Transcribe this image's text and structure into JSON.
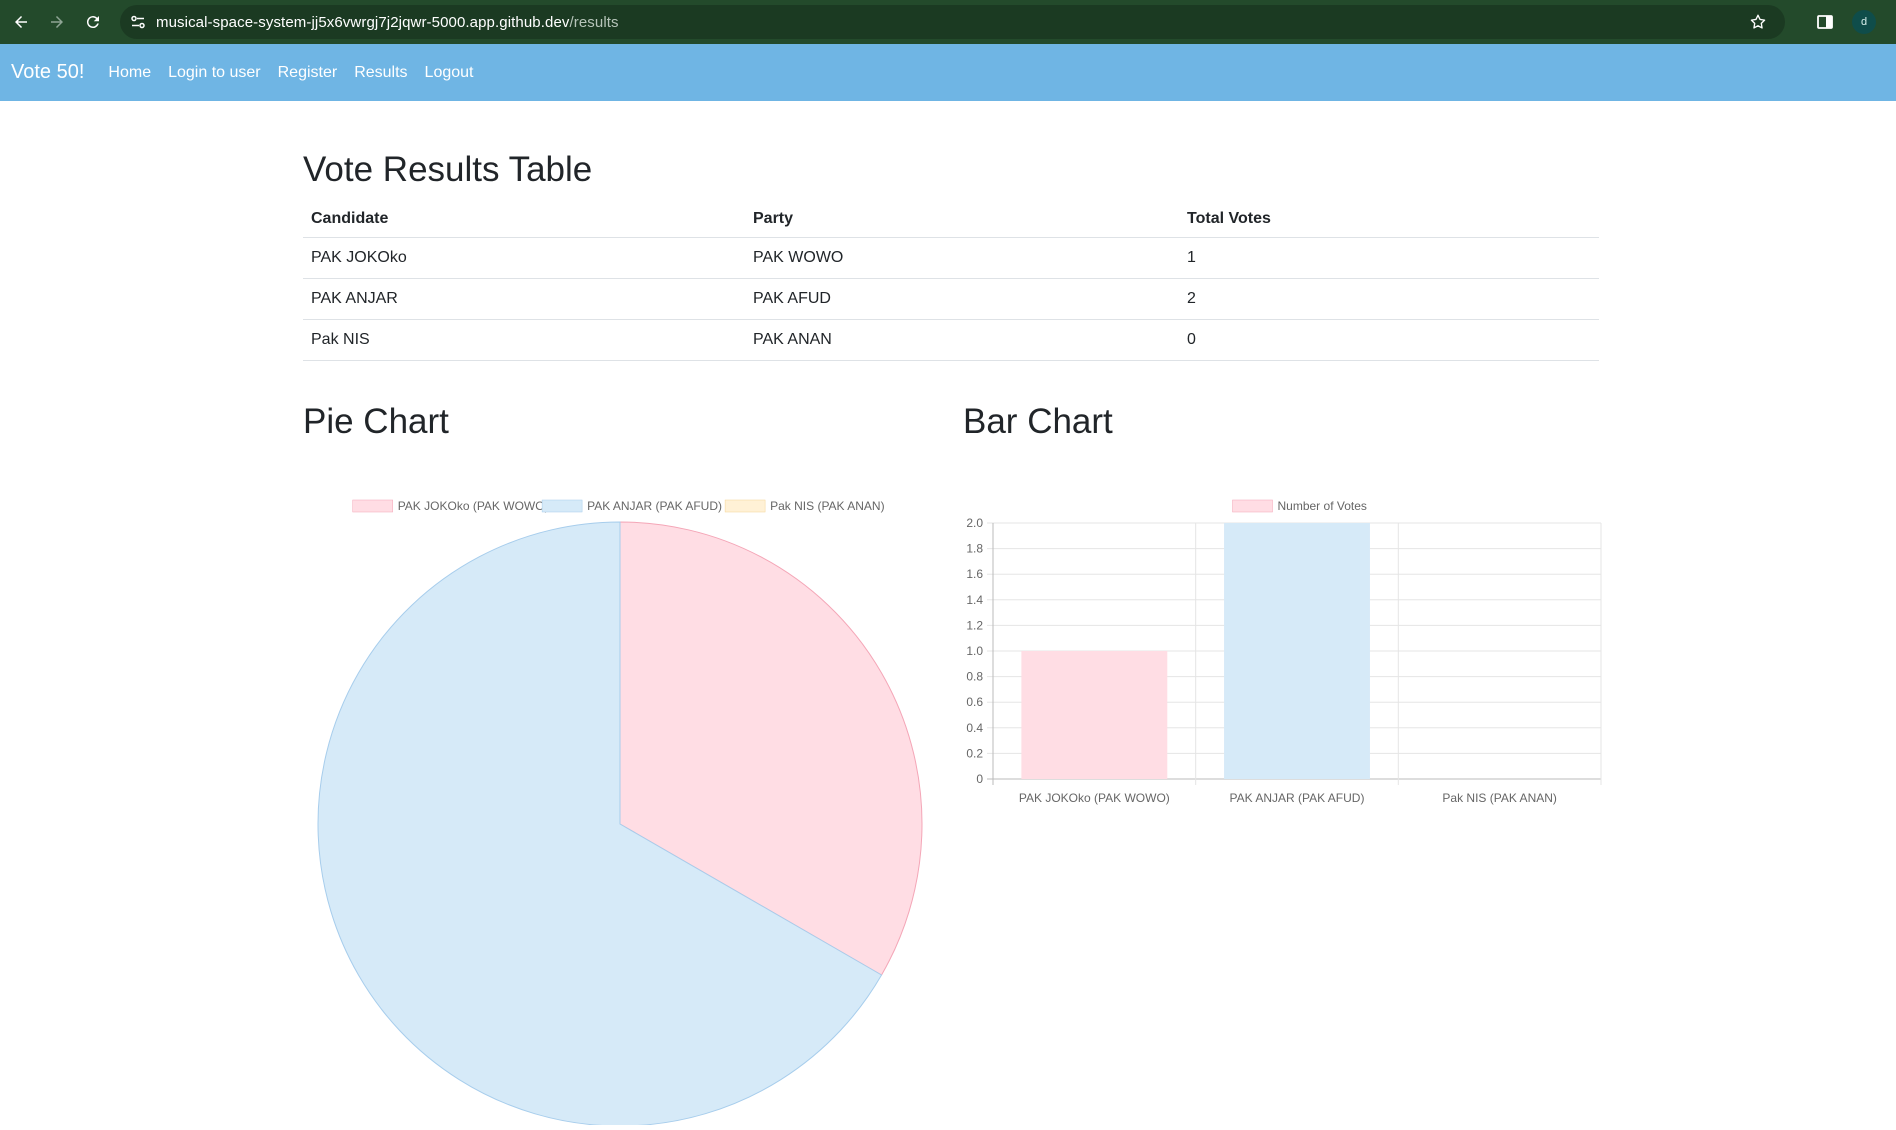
{
  "browser": {
    "url_host": "musical-space-system-jj5x6vwrgj7j2jqwr-5000.app.github.dev",
    "url_path": "/results",
    "profile_initial": "d"
  },
  "navbar": {
    "brand": "Vote 50!",
    "links": [
      "Home",
      "Login to user",
      "Register",
      "Results",
      "Logout"
    ]
  },
  "results_table": {
    "title": "Vote Results Table",
    "headers": [
      "Candidate",
      "Party",
      "Total Votes"
    ],
    "rows": [
      [
        "PAK JOKOko",
        "PAK WOWO",
        "1"
      ],
      [
        "PAK ANJAR",
        "PAK AFUD",
        "2"
      ],
      [
        "Pak NIS",
        "PAK ANAN",
        "0"
      ]
    ]
  },
  "chart_data": [
    {
      "type": "pie",
      "title": "Pie Chart",
      "categories": [
        "PAK JOKOko (PAK WOWO)",
        "PAK ANJAR (PAK AFUD)",
        "Pak NIS (PAK ANAN)"
      ],
      "values": [
        1,
        2,
        0
      ],
      "colors": [
        "#ffdde4",
        "#d6eaf8",
        "#fff1d6"
      ],
      "border_colors": [
        "#f4a6b7",
        "#a7cdec",
        "#f5d596"
      ],
      "legend": "top"
    },
    {
      "type": "bar",
      "title": "Bar Chart",
      "categories": [
        "PAK JOKOko (PAK WOWO)",
        "PAK ANJAR (PAK AFUD)",
        "Pak NIS (PAK ANAN)"
      ],
      "series": [
        {
          "name": "Number of Votes",
          "values": [
            1,
            2,
            0
          ]
        }
      ],
      "colors": [
        "#ffdde4",
        "#d6eaf8",
        "#fff1d6"
      ],
      "ylim": [
        0,
        2.0
      ],
      "yticks": [
        "2.0",
        "1.8",
        "1.6",
        "1.4",
        "1.2",
        "1.0",
        "0.8",
        "0.6",
        "0.4",
        "0.2",
        "0"
      ],
      "grid": true,
      "legend": "top"
    }
  ]
}
